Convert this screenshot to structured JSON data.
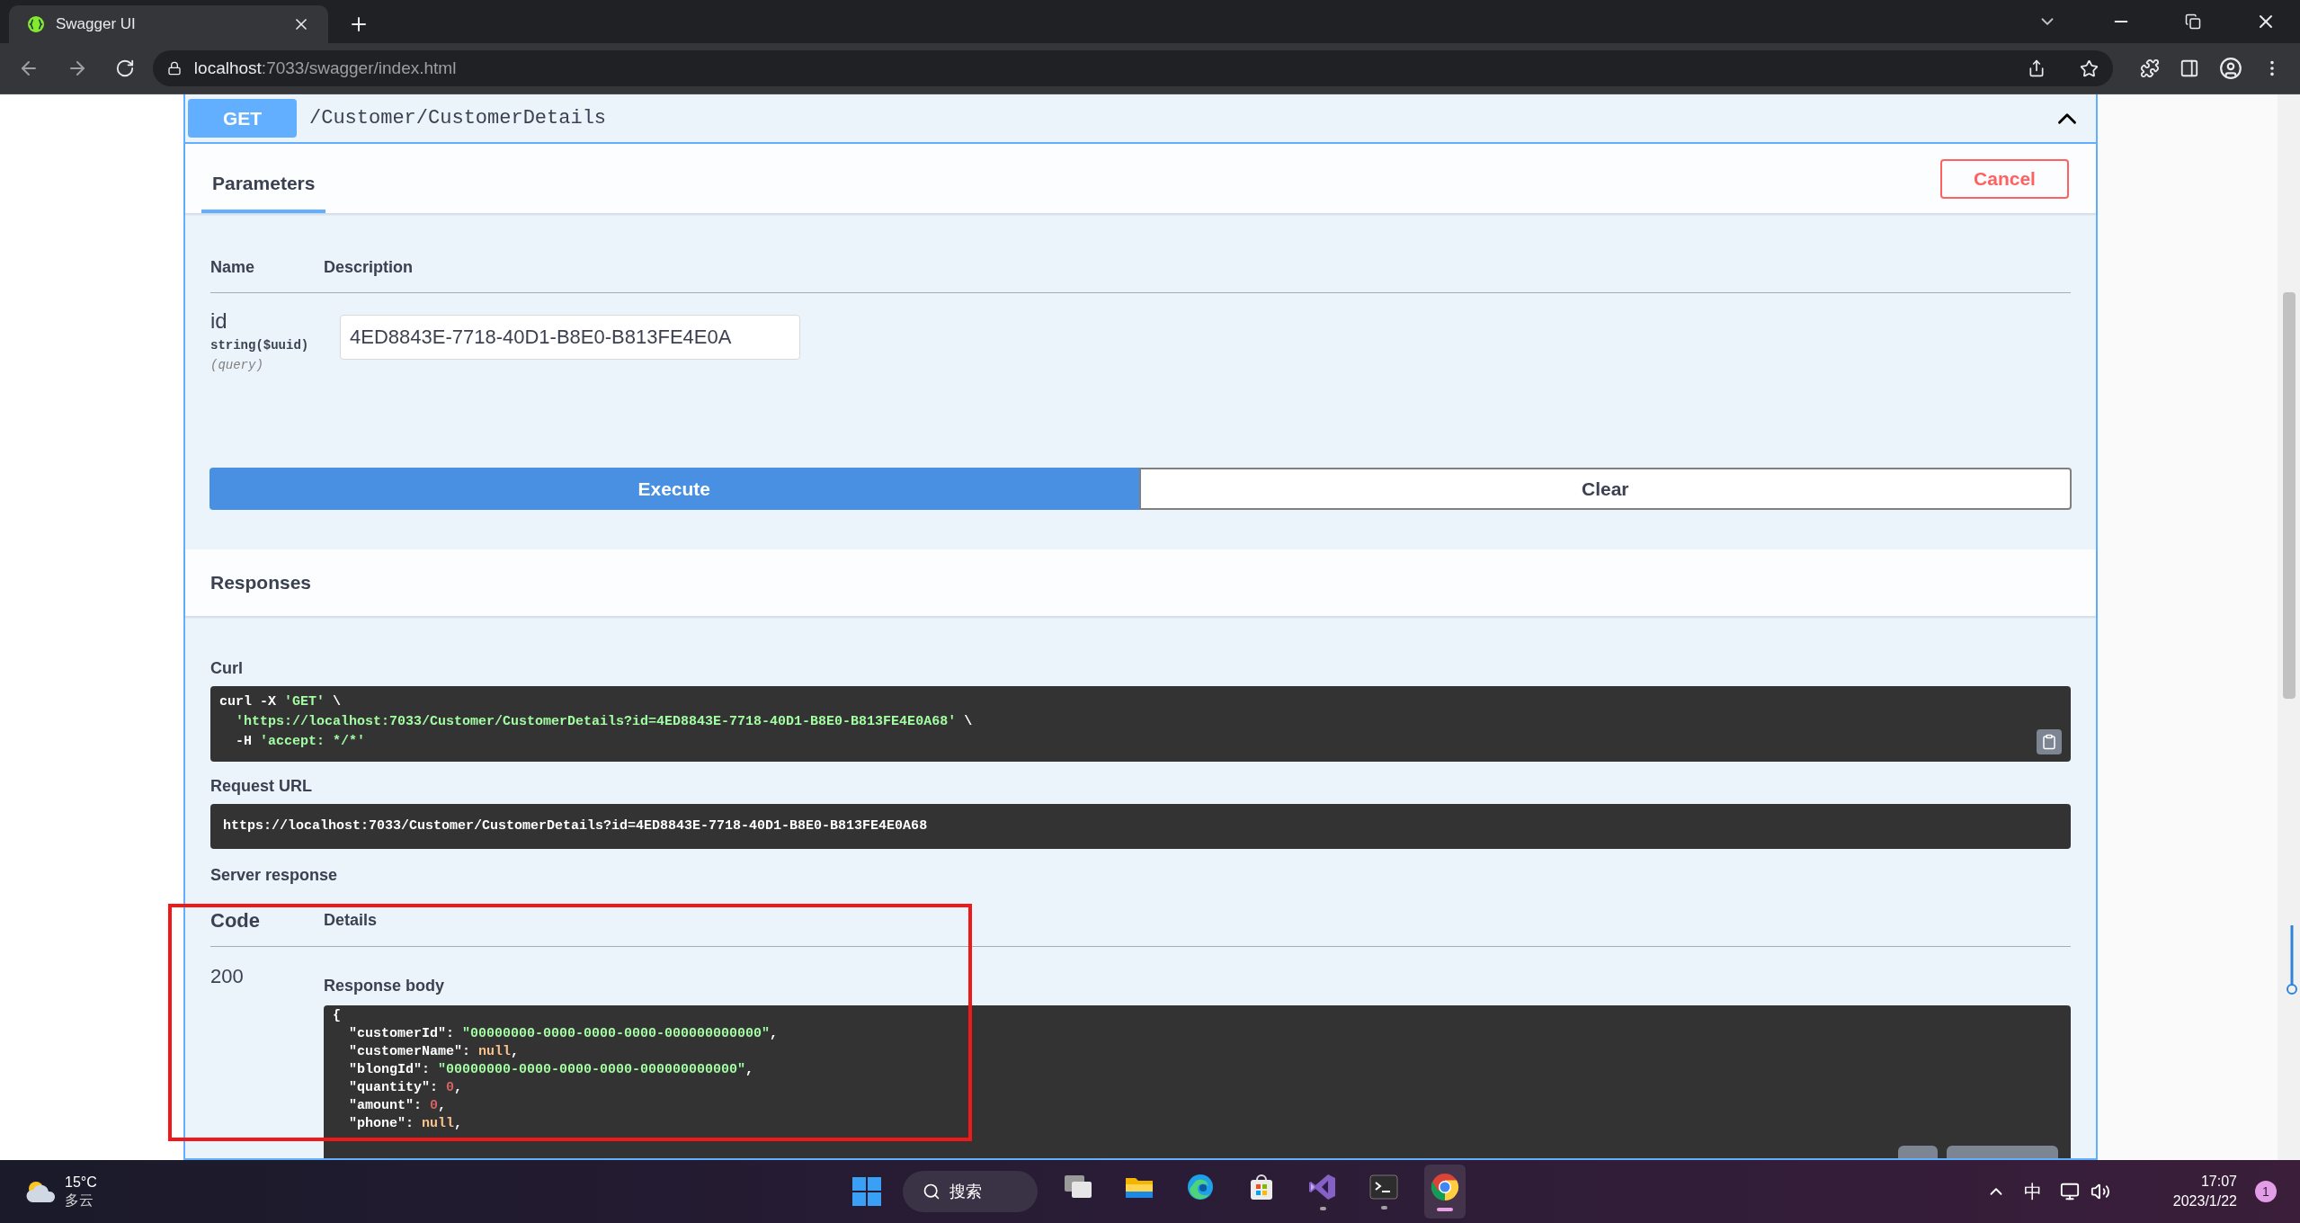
{
  "browser": {
    "tab_title": "Swagger UI",
    "url_host": "localhost",
    "url_path": ":7033/swagger/index.html"
  },
  "operation": {
    "method": "GET",
    "path": "/Customer/CustomerDetails",
    "expanded": true
  },
  "parameters": {
    "tab": {
      "label": "Parameters",
      "selected": true
    },
    "cancel": "Cancel",
    "columns": [
      "Name",
      "Description"
    ],
    "items": [
      {
        "name": "id",
        "type": "string($uuid)",
        "location": "(query)",
        "value": "4ED8843E-7718-40D1-B8E0-B813FE4E0A"
      }
    ]
  },
  "actions": [
    "Execute",
    "Clear"
  ],
  "responses": {
    "title": "Responses",
    "curl_label": "Curl",
    "curl_lines": [
      [
        {
          "t": "curl -X ",
          "kind": "plain"
        },
        {
          "t": "'GET'",
          "kind": "string"
        },
        {
          "t": " \\",
          "kind": "plain"
        }
      ],
      [
        {
          "t": "  'https://localhost:7033/Customer/CustomerDetails?id=4ED8843E-7718-40D1-B8E0-B813FE4E0A68'",
          "kind": "string"
        },
        {
          "t": " \\",
          "kind": "plain"
        }
      ],
      [
        {
          "t": "  -H ",
          "kind": "plain"
        },
        {
          "t": "'accept: */*'",
          "kind": "string"
        }
      ]
    ],
    "request_url_label": "Request URL",
    "request_url": "https://localhost:7033/Customer/CustomerDetails?id=4ED8843E-7718-40D1-B8E0-B813FE4E0A68",
    "server_response_label": "Server response",
    "columns": [
      "Code",
      "Details"
    ],
    "code": "200",
    "body_label": "Response body",
    "body_lines": [
      [
        {
          "t": "{",
          "kind": "plain"
        }
      ],
      [
        {
          "t": "  \"customerId\": ",
          "kind": "plain"
        },
        {
          "t": "\"00000000-0000-0000-0000-000000000000\"",
          "kind": "string"
        },
        {
          "t": ",",
          "kind": "plain"
        }
      ],
      [
        {
          "t": "  \"customerName\": ",
          "kind": "plain"
        },
        {
          "t": "null",
          "kind": "null"
        },
        {
          "t": ",",
          "kind": "plain"
        }
      ],
      [
        {
          "t": "  \"blongId\": ",
          "kind": "plain"
        },
        {
          "t": "\"00000000-0000-0000-0000-000000000000\"",
          "kind": "string"
        },
        {
          "t": ",",
          "kind": "plain"
        }
      ],
      [
        {
          "t": "  \"quantity\": ",
          "kind": "plain"
        },
        {
          "t": "0",
          "kind": "number"
        },
        {
          "t": ",",
          "kind": "plain"
        }
      ],
      [
        {
          "t": "  \"amount\": ",
          "kind": "plain"
        },
        {
          "t": "0",
          "kind": "number"
        },
        {
          "t": ",",
          "kind": "plain"
        }
      ],
      [
        {
          "t": "  \"phone\": ",
          "kind": "plain"
        },
        {
          "t": "null",
          "kind": "null"
        },
        {
          "t": ",",
          "kind": "plain"
        }
      ]
    ]
  },
  "taskbar": {
    "temperature": "15°C",
    "condition": "多云",
    "search": "搜索",
    "apps": [
      {
        "kind": "taskview",
        "running": false,
        "selected": false
      },
      {
        "kind": "explorer",
        "running": false,
        "selected": false
      },
      {
        "kind": "edge",
        "running": false,
        "selected": false
      },
      {
        "kind": "store",
        "running": false,
        "selected": false
      },
      {
        "kind": "visualstudio",
        "running": true,
        "selected": false
      },
      {
        "kind": "terminal",
        "running": true,
        "selected": false
      },
      {
        "kind": "chrome",
        "running": true,
        "selected": true
      }
    ],
    "ime": "中",
    "time": "17:07",
    "date": "2023/1/22",
    "notifications": "1"
  }
}
